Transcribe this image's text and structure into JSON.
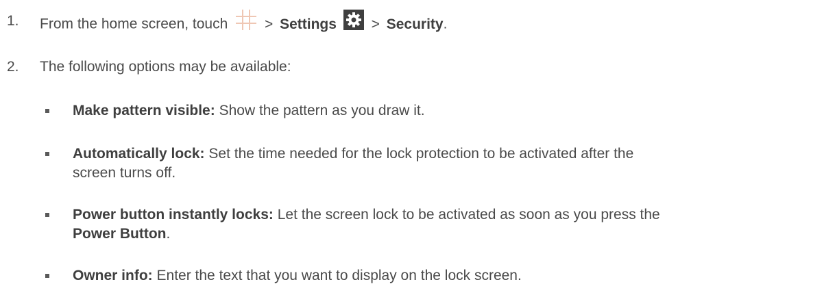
{
  "step1": {
    "number": "1.",
    "prefix": "From the home screen, touch",
    "sep1": ">",
    "settings": "Settings",
    "sep2": ">",
    "security": "Security",
    "end": ".",
    "icons": [
      "apps-grid-icon",
      "settings-gear-icon"
    ]
  },
  "step2": {
    "number": "2.",
    "text": "The following options may be available:"
  },
  "options": [
    {
      "title": "Make pattern visible:",
      "desc": "Show the pattern as you draw it."
    },
    {
      "title": "Automatically lock:",
      "desc": "Set the time needed for the lock protection to be activated after the",
      "desc2": "screen turns off."
    },
    {
      "title": "Power button instantly locks:",
      "desc": "Let the screen lock to be activated as soon as you press the",
      "bold2": "Power Button",
      "end": "."
    },
    {
      "title": "Owner info:",
      "desc": "Enter the text that you want to display on the lock screen."
    }
  ],
  "colors": {
    "text": "#4a4a4a",
    "grid_icon": "#efc7b4",
    "gear_icon_bg": "#3f3f3f"
  }
}
